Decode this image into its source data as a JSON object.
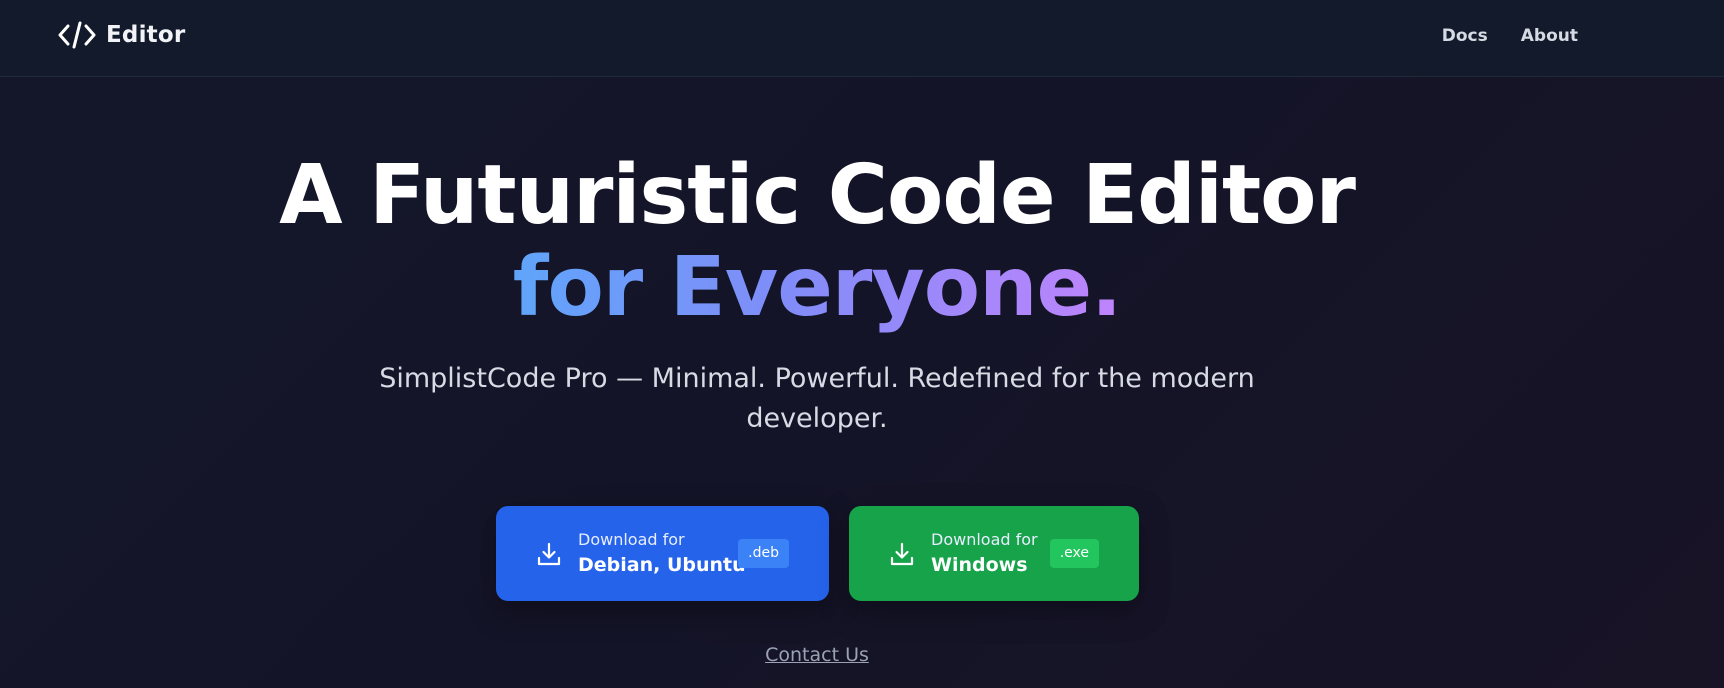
{
  "nav": {
    "brand": "Editor",
    "links": [
      "Docs",
      "About"
    ]
  },
  "hero": {
    "headline_line1": "A Futuristic Code Editor",
    "headline_line2": "for Everyone.",
    "subtitle": "SimplistCode Pro — Minimal. Powerful. Redefined for the modern developer."
  },
  "downloads": [
    {
      "prefix": "Download for",
      "platform": "Debian, Ubuntu",
      "badge": ".deb",
      "color": "#2563eb"
    },
    {
      "prefix": "Download for",
      "platform": "Windows",
      "badge": ".exe",
      "color": "#16a34a"
    }
  ],
  "contact": {
    "label": "Contact Us"
  },
  "icons": {
    "brand": "code-icon",
    "download": "download-icon"
  }
}
